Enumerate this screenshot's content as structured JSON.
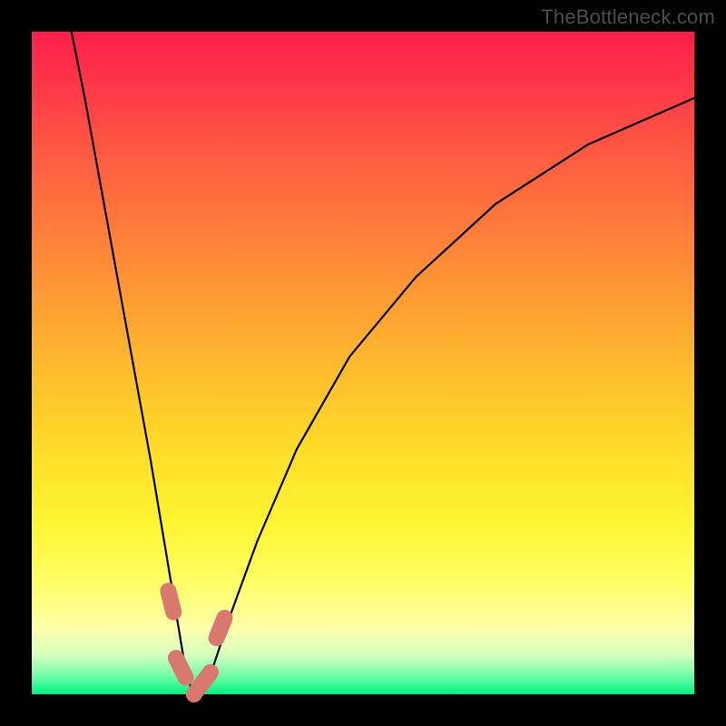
{
  "watermark": "TheBottleneck.com",
  "colors": {
    "background": "#000000",
    "curve_stroke": "#000000",
    "marker_stroke": "#d9786f",
    "gradient_top": "#ff1e4b",
    "gradient_bottom": "#00f082"
  },
  "chart_data": {
    "type": "line",
    "title": "",
    "xlabel": "",
    "ylabel": "",
    "xlim": [
      0,
      100
    ],
    "ylim": [
      0,
      100
    ],
    "note": "V-shaped bottleneck curve. y≈100 at the extremes, dipping to ≈0 at the trough near x≈24. Left branch is steeper than the right branch. Coral markers highlight the trough and its two shoulders.",
    "series": [
      {
        "name": "bottleneck-curve",
        "x": [
          6,
          8,
          10,
          12,
          14,
          16,
          18,
          20,
          22,
          23,
          24,
          25,
          26,
          27,
          28,
          30,
          34,
          40,
          48,
          58,
          70,
          84,
          100
        ],
        "y": [
          100,
          90,
          79,
          68,
          57,
          46,
          35,
          23,
          11,
          5,
          1,
          0,
          1,
          3,
          6,
          12,
          23,
          37,
          51,
          63,
          74,
          83,
          90
        ]
      }
    ],
    "markers": [
      {
        "name": "left-shoulder",
        "x": 21.0,
        "y": 14
      },
      {
        "name": "trough-left",
        "x": 22.5,
        "y": 4
      },
      {
        "name": "trough-bottom",
        "x": 24.5,
        "y": 0
      },
      {
        "name": "trough-right",
        "x": 26.0,
        "y": 2
      },
      {
        "name": "right-shoulder",
        "x": 28.5,
        "y": 10
      }
    ]
  }
}
